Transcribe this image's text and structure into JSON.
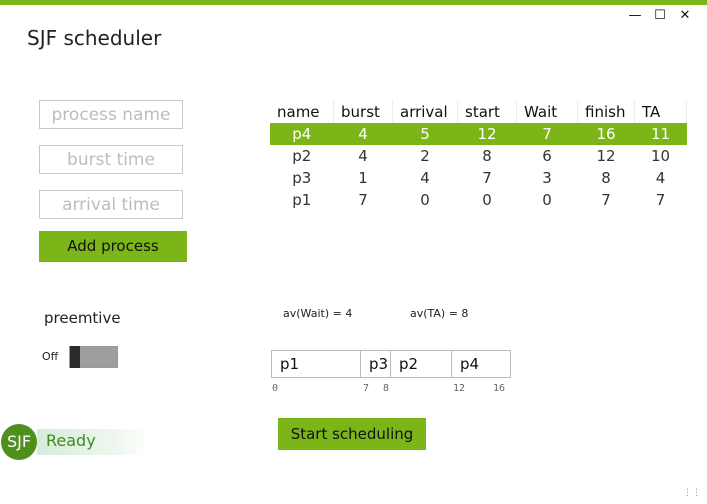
{
  "window": {
    "title": "SJF scheduler",
    "minimize_glyph": "—",
    "maximize_glyph": "☐",
    "close_glyph": "✕"
  },
  "form": {
    "process_name_placeholder": "process name",
    "burst_time_placeholder": "burst time",
    "arrival_time_placeholder": "arrival time",
    "add_button_label": "Add process"
  },
  "preemptive": {
    "label": "preemtive",
    "state_label": "Off",
    "enabled": false
  },
  "table": {
    "columns": [
      "name",
      "burst",
      "arrival",
      "start",
      "Wait",
      "finish",
      "TA"
    ],
    "rows": [
      [
        "p4",
        "4",
        "5",
        "12",
        "7",
        "16",
        "11"
      ],
      [
        "p2",
        "4",
        "2",
        "8",
        "6",
        "12",
        "10"
      ],
      [
        "p3",
        "1",
        "4",
        "7",
        "3",
        "8",
        "4"
      ],
      [
        "p1",
        "7",
        "0",
        "0",
        "0",
        "7",
        "7"
      ]
    ],
    "selected_row": 0
  },
  "averages": {
    "wait": "av(Wait) = 4",
    "ta": "av(TA) = 8"
  },
  "gantt": {
    "segments": [
      {
        "label": "p1",
        "start": 0,
        "end": 7
      },
      {
        "label": "p3",
        "start": 7,
        "end": 8
      },
      {
        "label": "p2",
        "start": 8,
        "end": 12
      },
      {
        "label": "p4",
        "start": 12,
        "end": 16
      }
    ],
    "ticks": [
      "0",
      "7",
      "8",
      "12",
      "16"
    ]
  },
  "start_button_label": "Start scheduling",
  "status": {
    "logo": "SJF",
    "text": "Ready"
  },
  "colors": {
    "accent": "#7cb518",
    "status_text": "#3f8a20"
  }
}
